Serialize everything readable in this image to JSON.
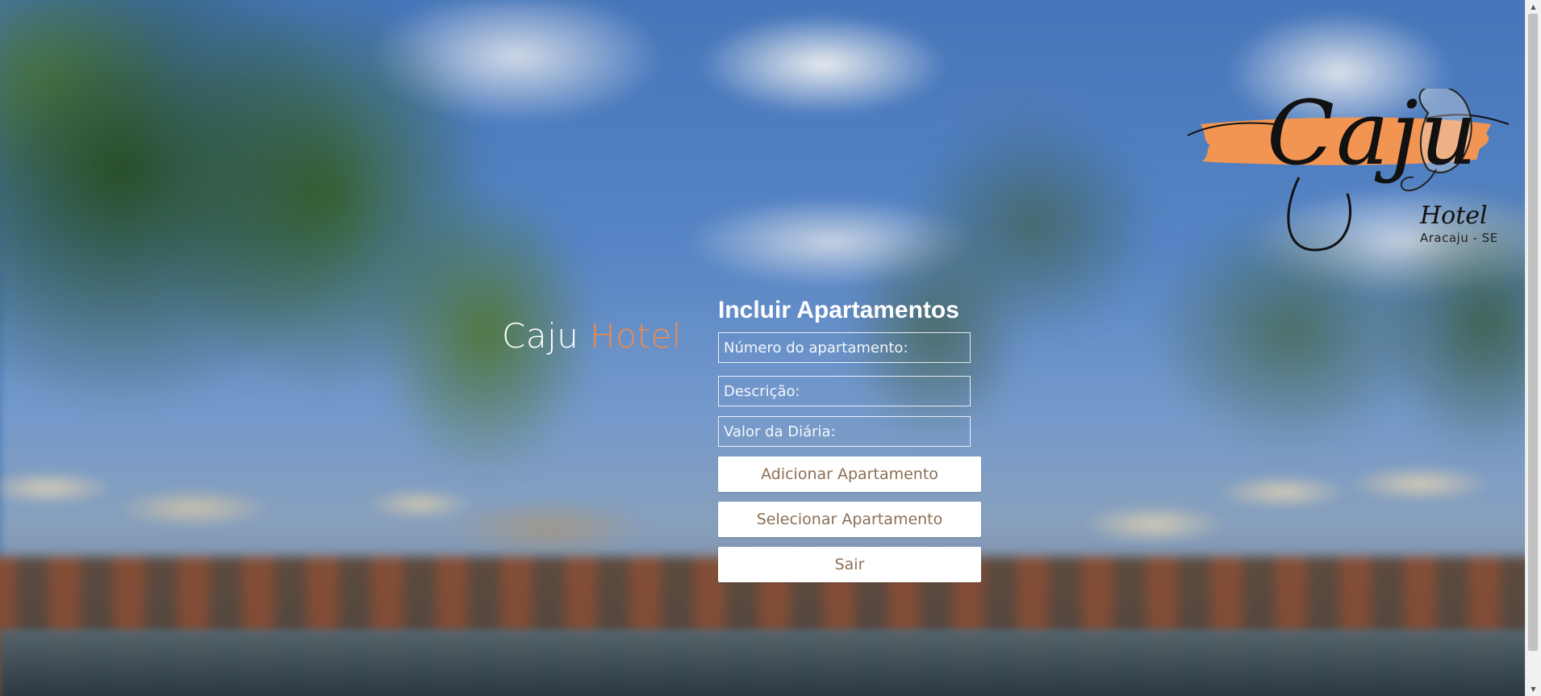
{
  "logo": {
    "script": "Caju",
    "sub": "Hotel",
    "city": "Aracaju - SE"
  },
  "brand": {
    "word1": "Caju",
    "word2": "Hotel"
  },
  "form": {
    "heading": "Incluir Apartamentos",
    "fields": {
      "numero_placeholder": "Número do apartamento:",
      "descricao_placeholder": "Descrição:",
      "valor_placeholder": "Valor da Diária:"
    },
    "buttons": {
      "adicionar": "Adicionar Apartamento",
      "selecionar": "Selecionar Apartamento",
      "sair": "Sair"
    }
  },
  "scrollbar": {
    "up_icon": "▲",
    "down_icon": "▼"
  },
  "colors": {
    "accent": "#f08a4b",
    "button_text": "#8c6f55",
    "logo_brush": "#f39552"
  }
}
